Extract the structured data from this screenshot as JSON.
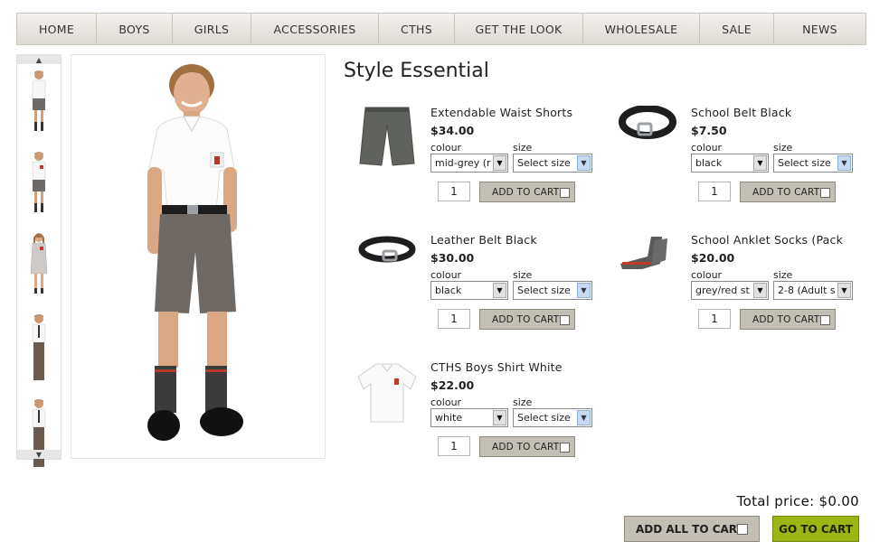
{
  "nav": {
    "items": [
      "HOME",
      "BOYS",
      "GIRLS",
      "ACCESSORIES",
      "CTHS",
      "GET THE LOOK",
      "WHOLESALE",
      "SALE",
      "NEWS"
    ]
  },
  "page": {
    "title": "Style Essential"
  },
  "products": [
    {
      "name": "Extendable Waist Shorts",
      "price": "$34.00",
      "colour_label": "colour",
      "size_label": "size",
      "colour_value": "mid-grey (r",
      "size_value": "Select size",
      "qty": "1",
      "add_label": "ADD TO CART"
    },
    {
      "name": "School Belt Black",
      "price": "$7.50",
      "colour_label": "colour",
      "size_label": "size",
      "colour_value": "black",
      "size_value": "Select size",
      "qty": "1",
      "add_label": "ADD TO CART"
    },
    {
      "name": "Leather Belt Black",
      "price": "$30.00",
      "colour_label": "colour",
      "size_label": "size",
      "colour_value": "black",
      "size_value": "Select size",
      "qty": "1",
      "add_label": "ADD TO CART"
    },
    {
      "name": "School Anklet Socks (Pack",
      "price": "$20.00",
      "colour_label": "colour",
      "size_label": "size",
      "colour_value": "grey/red st",
      "size_value": "2-8 (Adult s",
      "qty": "1",
      "add_label": "ADD TO CART"
    },
    {
      "name": "CTHS Boys Shirt White",
      "price": "$22.00",
      "colour_label": "colour",
      "size_label": "size",
      "colour_value": "white",
      "size_value": "Select size",
      "qty": "1",
      "add_label": "ADD TO CART"
    }
  ],
  "footer": {
    "total_label": "Total price: $0.00",
    "add_all_label": "ADD ALL TO CART",
    "go_to_cart_label": "GO TO CART"
  },
  "icons": {
    "thumb_up": "chevron-up-icon",
    "thumb_down": "chevron-down-icon",
    "select_arrow": "caret-down-icon"
  },
  "colors": {
    "nav_bg": "#e8e5e0",
    "cart_button": "#c4bfb4",
    "go_to_cart": "#9bb612"
  }
}
